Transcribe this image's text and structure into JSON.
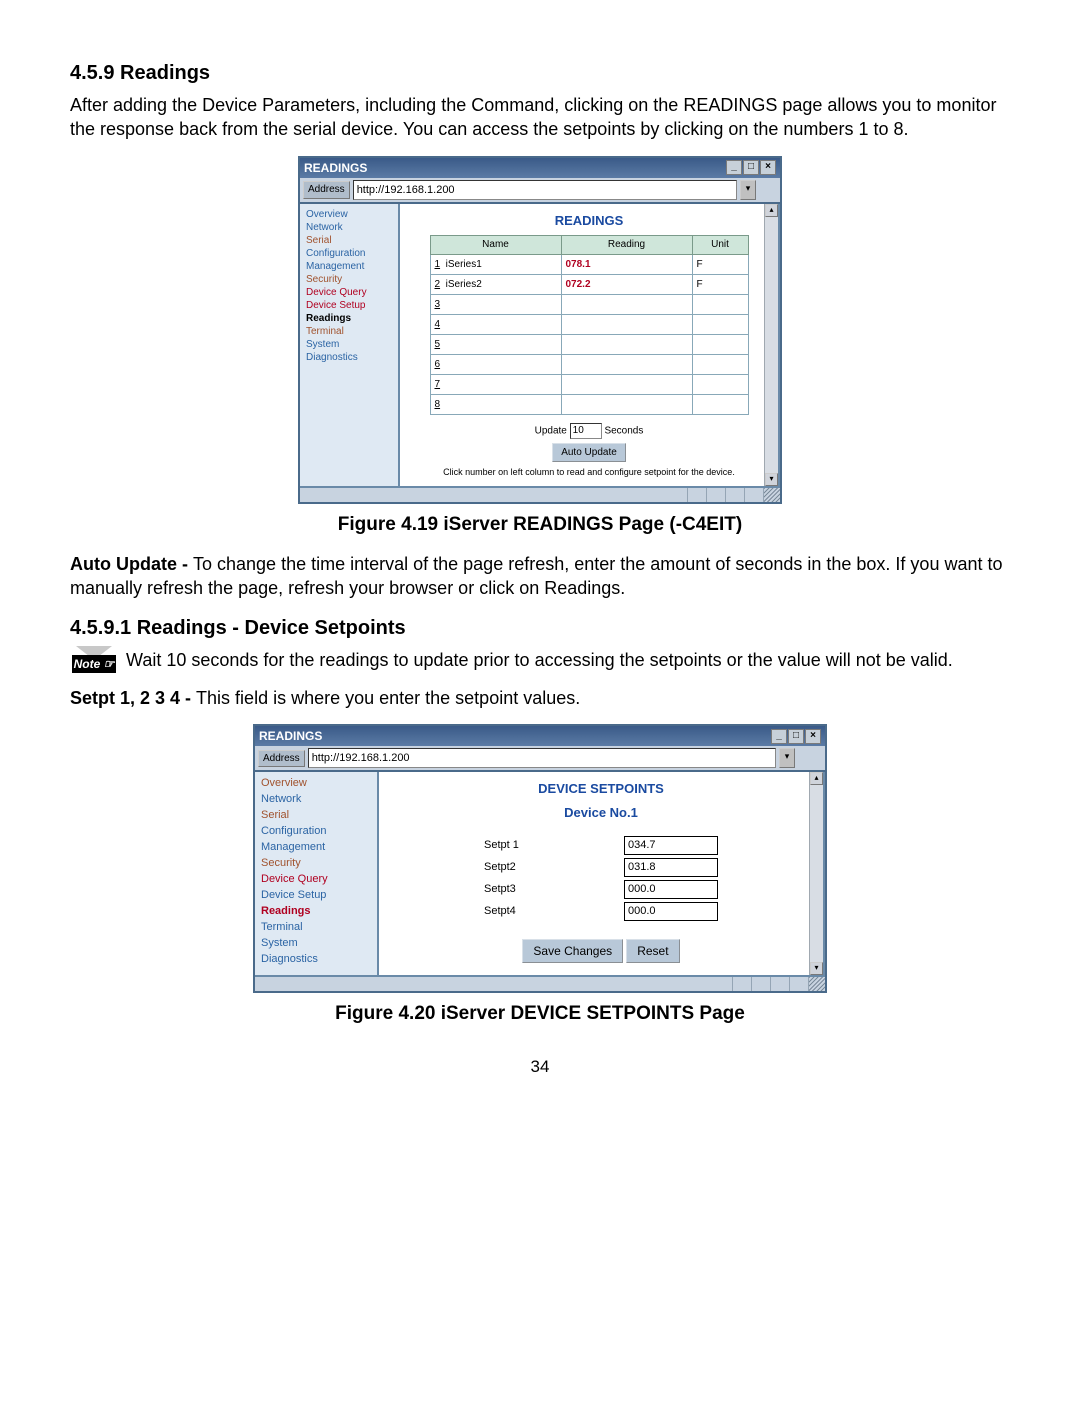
{
  "doc": {
    "sec1_num": "4.5.9  Readings",
    "sec1_p1": "After adding the Device Parameters, including the Command, clicking on the READINGS page allows you to monitor the response back from the serial device. You can access the setpoints by clicking on the numbers 1 to 8.",
    "fig419_caption": "Figure 4.19  iServer READINGS Page (-C4EIT)",
    "auto_update_lead": "Auto Update - ",
    "auto_update_body": "To change the time interval of the page refresh, enter the amount of seconds in the box.  If you want to manually refresh the page, refresh your browser or click on Readings.",
    "sec2_num": "4.5.9.1  Readings - Device Setpoints",
    "note_icon": "Note ☞",
    "note_body": "Wait 10 seconds for the readings to update prior to accessing the setpoints or the value will not be valid.",
    "setpt_lead": "Setpt 1, 2 3 4 - ",
    "setpt_body": " This field is where you enter the setpoint values.",
    "fig420_caption": "Figure 4.20  iServer DEVICE SETPOINTS Page",
    "page_number": "34"
  },
  "win": {
    "title": "READINGS",
    "addr_label": "Address",
    "addr_value": "http://192.168.1.200"
  },
  "nav": {
    "overview": "Overview",
    "network": "Network",
    "serial": "Serial",
    "configuration": "Configuration",
    "management": "Management",
    "security": "Security",
    "device_query": "Device Query",
    "device_setup": "Device Setup",
    "readings": "Readings",
    "terminal": "Terminal",
    "system": "System",
    "diagnostics": "Diagnostics"
  },
  "readings": {
    "title": "READINGS",
    "th_name": "Name",
    "th_reading": "Reading",
    "th_unit": "Unit",
    "rows": [
      {
        "n": "1",
        "name": "iSeries1",
        "reading": "078.1",
        "unit": "F"
      },
      {
        "n": "2",
        "name": "iSeries2",
        "reading": "072.2",
        "unit": "F"
      },
      {
        "n": "3",
        "name": "",
        "reading": "",
        "unit": ""
      },
      {
        "n": "4",
        "name": "",
        "reading": "",
        "unit": ""
      },
      {
        "n": "5",
        "name": "",
        "reading": "",
        "unit": ""
      },
      {
        "n": "6",
        "name": "",
        "reading": "",
        "unit": ""
      },
      {
        "n": "7",
        "name": "",
        "reading": "",
        "unit": ""
      },
      {
        "n": "8",
        "name": "",
        "reading": "",
        "unit": ""
      }
    ],
    "update_lbl": "Update",
    "update_val": "10",
    "seconds": "Seconds",
    "auto_btn": "Auto Update",
    "hint": "Click number on left column to read and configure setpoint for the device."
  },
  "setpoints": {
    "title": "DEVICE SETPOINTS",
    "subtitle": "Device No.1",
    "rows": [
      {
        "label": "Setpt 1",
        "value": "034.7"
      },
      {
        "label": "Setpt2",
        "value": "031.8"
      },
      {
        "label": "Setpt3",
        "value": "000.0"
      },
      {
        "label": "Setpt4",
        "value": "000.0"
      }
    ],
    "save_btn": "Save Changes",
    "reset_btn": "Reset"
  }
}
